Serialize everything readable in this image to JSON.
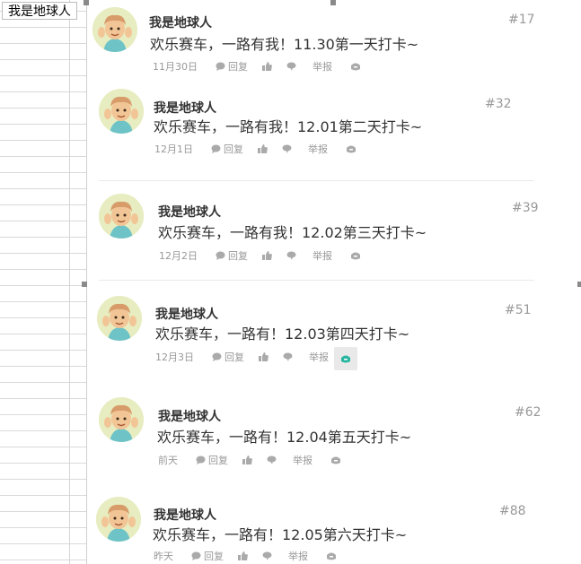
{
  "sheet": {
    "cell_text": "我是地球人"
  },
  "posts": [
    {
      "user": "我是地球人",
      "content": "欢乐赛车，一路有我！11.30第一天打卡~",
      "floor": "#17",
      "date": "11月30日",
      "reply_label": "回复",
      "report_label": "举报"
    },
    {
      "user": "我是地球人",
      "content": "欢乐赛车，一路有我！12.01第二天打卡~",
      "floor": "#32",
      "date": "12月1日",
      "reply_label": "回复",
      "report_label": "举报"
    },
    {
      "user": "我是地球人",
      "content": "欢乐赛车，一路有我！12.02第三天打卡~",
      "floor": "#39",
      "date": "12月2日",
      "reply_label": "回复",
      "report_label": "举报"
    },
    {
      "user": "我是地球人",
      "content": "欢乐赛车，一路有！12.03第四天打卡~",
      "floor": "#51",
      "date": "12月3日",
      "reply_label": "回复",
      "report_label": "举报"
    },
    {
      "user": "我是地球人",
      "content": "欢乐赛车，一路有！12.04第五天打卡~",
      "floor": "#62",
      "date": "前天",
      "reply_label": "回复",
      "report_label": "举报"
    },
    {
      "user": "我是地球人",
      "content": "欢乐赛车，一路有！12.05第六天打卡~",
      "floor": "#88",
      "date": "昨天",
      "reply_label": "回复",
      "report_label": "举报"
    }
  ],
  "icons": {
    "reply": "chat-bubble-icon",
    "like": "thumbs-up-icon",
    "dislike": "thumbs-down-icon",
    "share": "share-icon"
  },
  "colors": {
    "text": "#333333",
    "muted": "#999999",
    "icon": "#aaaaaa",
    "share_active": "#29b6a0",
    "avatar_bg": "#e7edc0"
  }
}
